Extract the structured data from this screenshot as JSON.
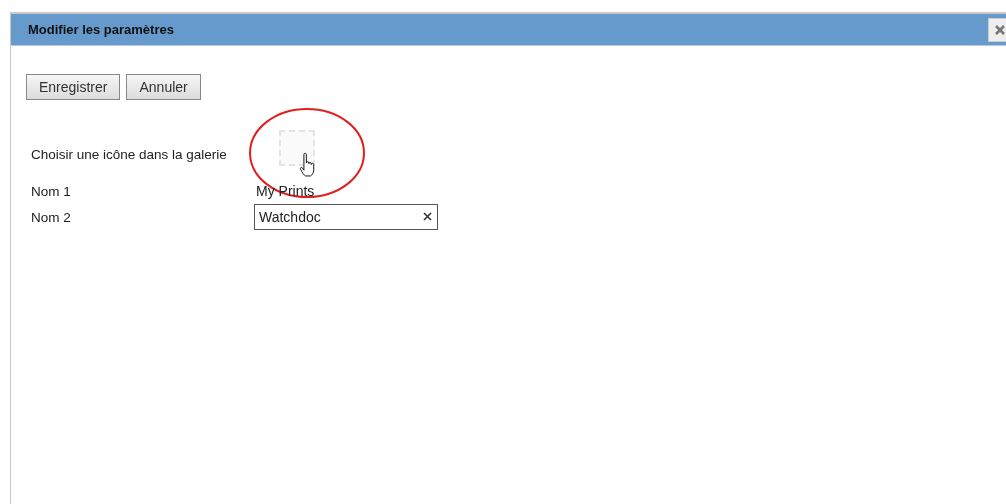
{
  "dialog": {
    "title": "Modifier les paramètres"
  },
  "buttons": [
    {
      "label": "Enregistrer"
    },
    {
      "label": "Annuler"
    }
  ],
  "gallery": {
    "label": "Choisir une icône dans la galerie"
  },
  "fields": [
    {
      "kind": "static",
      "label": "Nom 1",
      "value": "My Prints"
    },
    {
      "kind": "input",
      "label": "Nom 2",
      "value": "Watchdoc"
    }
  ]
}
